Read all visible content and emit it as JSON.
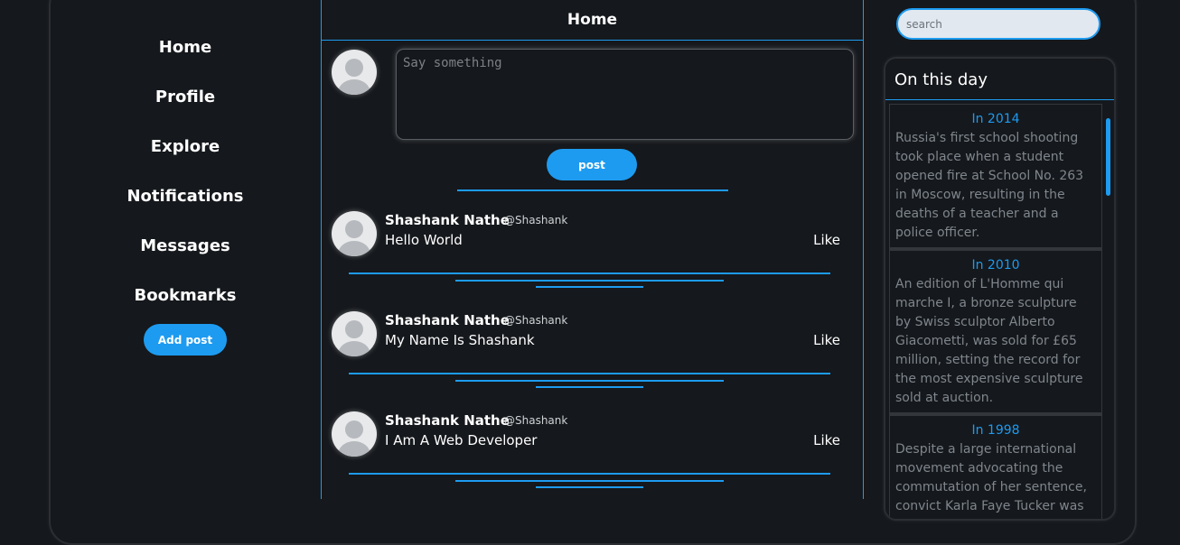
{
  "nav": {
    "items": [
      {
        "label": "Home"
      },
      {
        "label": "Profile"
      },
      {
        "label": "Explore"
      },
      {
        "label": "Notifications"
      },
      {
        "label": "Messages"
      },
      {
        "label": "Bookmarks"
      }
    ],
    "add_post_label": "Add post"
  },
  "feed": {
    "title": "Home",
    "compose_placeholder": "Say something",
    "post_button_label": "post",
    "posts": [
      {
        "name": "Shashank Nathe",
        "handle": "@Shashank",
        "text": "Hello World",
        "like_label": "Like"
      },
      {
        "name": "Shashank Nathe",
        "handle": "@Shashank",
        "text": "My Name Is Shashank",
        "like_label": "Like"
      },
      {
        "name": "Shashank Nathe",
        "handle": "@Shashank",
        "text": "I Am A Web Developer",
        "like_label": "Like"
      }
    ]
  },
  "search": {
    "placeholder": "search"
  },
  "on_this_day": {
    "title": "On this day",
    "events": [
      {
        "year": "In 2014",
        "text": "Russia's first school shooting took place when a student opened fire at School No. 263 in Moscow, resulting in the deaths of a teacher and a police officer."
      },
      {
        "year": "In 2010",
        "text": "An edition of L'Homme qui marche I, a bronze sculpture by Swiss sculptor Alberto Giacometti, was sold for £65 million, setting the record for the most expensive sculpture sold at auction."
      },
      {
        "year": "In 1998",
        "text": "Despite a large international movement advocating the commutation of her sentence, convict Karla Faye Tucker was executed by lethal injection in Texas."
      }
    ]
  },
  "colors": {
    "accent": "#1d9bf0",
    "background": "#15181c",
    "muted_text": "#7f868d"
  }
}
